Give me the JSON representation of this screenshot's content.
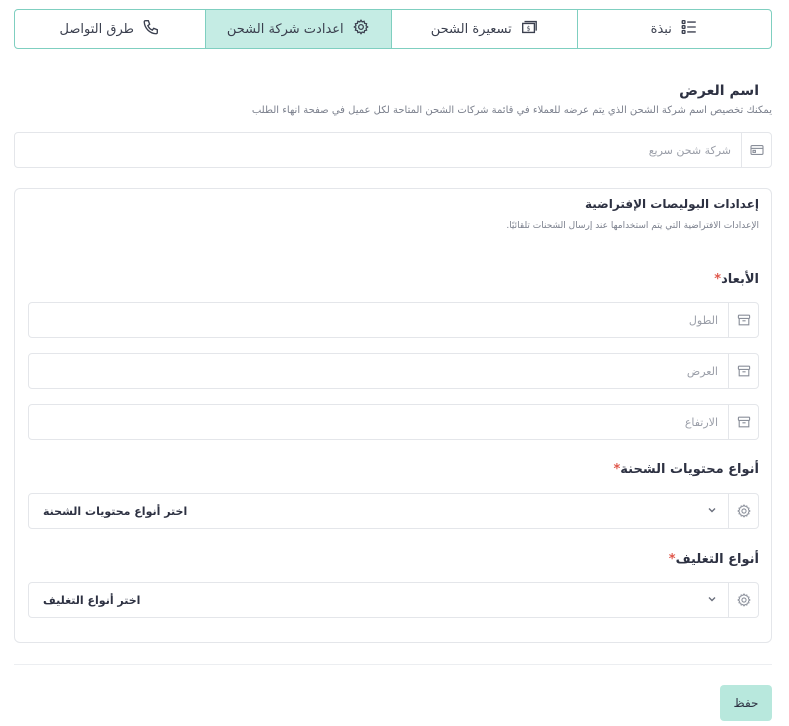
{
  "tabs": [
    {
      "label": "نبذة",
      "icon": "list-icon",
      "active": false
    },
    {
      "label": "تسعيرة الشحن",
      "icon": "money-icon",
      "active": false
    },
    {
      "label": "اعدادت شركة الشحن",
      "icon": "gear-icon",
      "active": true
    },
    {
      "label": "طرق التواصل",
      "icon": "phone-icon",
      "active": false
    }
  ],
  "display_name": {
    "title": "اسم العرض",
    "description": "يمكنك تخصيص اسم شركة الشحن الذي يتم عرضه للعملاء في قائمة شركات الشحن المتاحة لكل عميل في صفحة انهاء الطلب",
    "placeholder": "شركة شحن سريع"
  },
  "policy_defaults": {
    "title": "إعدادات البوليصات الإفتراضية",
    "description": "الإعدادات الافتراضية التي يتم استخدامها عند إرسال الشحنات تلقائيًا.",
    "dimensions": {
      "label": "الأبعاد",
      "required_mark": "*",
      "length_placeholder": "الطول",
      "width_placeholder": "العرض",
      "height_placeholder": "الارتفاع"
    },
    "contents": {
      "label": "أنواع محتويات الشحنة",
      "required_mark": "*",
      "select_text": "اختر أنواع محتويات الشحنة"
    },
    "packaging": {
      "label": "أنواع التغليف",
      "required_mark": "*",
      "select_text": "اختر أنواع التغليف"
    }
  },
  "save_label": "حفظ",
  "colors": {
    "accent_border": "#7fcfc0",
    "active_tab": "#c5ece4",
    "save_button": "#b8e8dd",
    "required": "#e0584c"
  }
}
